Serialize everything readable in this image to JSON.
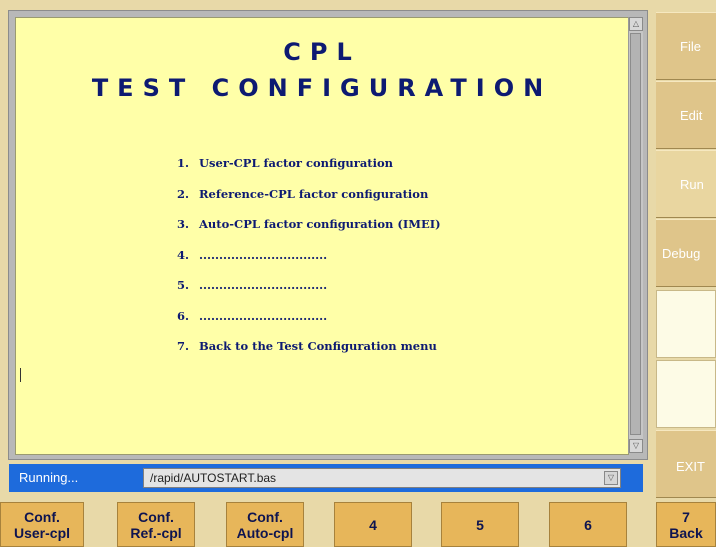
{
  "screen": {
    "title_line1": "CPL",
    "title_line2": "TEST CONFIGURATION",
    "menu_items": [
      {
        "num": "1.",
        "label": "User-CPL factor configuration"
      },
      {
        "num": "2.",
        "label": "Reference-CPL factor configuration"
      },
      {
        "num": "3.",
        "label": "Auto-CPL factor configuration (IMEI)"
      },
      {
        "num": "4.",
        "label": "................................"
      },
      {
        "num": "5.",
        "label": "................................"
      },
      {
        "num": "6.",
        "label": "................................"
      },
      {
        "num": "7.",
        "label": "Back to the Test Configuration menu"
      }
    ]
  },
  "status": {
    "state": "Running...",
    "path": "/rapid/AUTOSTART.bas"
  },
  "sidebar": {
    "file": "File",
    "edit": "Edit",
    "run": "Run",
    "debug": "Debug",
    "exit": "EXIT"
  },
  "fkeys": {
    "f1_line1": "Conf.",
    "f1_line2": "User-cpl",
    "f2_line1": "Conf.",
    "f2_line2": "Ref.-cpl",
    "f3_line1": "Conf.",
    "f3_line2": "Auto-cpl",
    "f4": "4",
    "f5": "5",
    "f6": "6",
    "f7_line1": "7",
    "f7_line2": "Back"
  },
  "icons": {
    "scroll_up": "triangle-up-icon",
    "scroll_down": "triangle-down-icon",
    "dropdown": "triangle-down-icon"
  }
}
